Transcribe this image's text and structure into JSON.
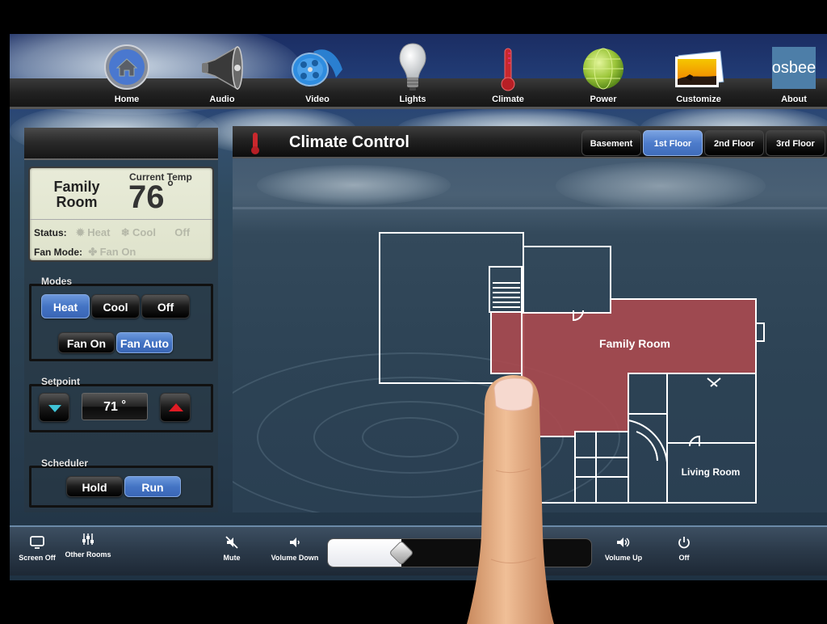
{
  "nav": {
    "items": [
      {
        "label": "Home",
        "icon": "home-icon",
        "active": true
      },
      {
        "label": "Audio",
        "icon": "speaker-icon"
      },
      {
        "label": "Video",
        "icon": "film-reel-icon"
      },
      {
        "label": "Lights",
        "icon": "light-bulb-icon"
      },
      {
        "label": "Climate",
        "icon": "thermometer-icon"
      },
      {
        "label": "Power",
        "icon": "globe-icon"
      },
      {
        "label": "Customize",
        "icon": "photos-icon"
      },
      {
        "label": "About",
        "icon": "osbee-logo-icon"
      }
    ],
    "logo_text": "osbee"
  },
  "status": {
    "room_name_line1": "Family",
    "room_name_line2": "Room",
    "current_temp_label": "Current Temp",
    "current_temp": "76",
    "degree_symbol": "°",
    "status_label": "Status:",
    "status_options": [
      "Heat",
      "Cool",
      "Off"
    ],
    "fan_mode_label": "Fan Mode:",
    "fan_mode_value": "Fan On"
  },
  "modes": {
    "title": "Modes",
    "buttons": [
      {
        "label": "Heat",
        "active": true
      },
      {
        "label": "Cool",
        "active": false
      },
      {
        "label": "Off",
        "active": false
      }
    ],
    "fan_buttons": [
      {
        "label": "Fan On",
        "active": false
      },
      {
        "label": "Fan Auto",
        "active": true
      }
    ]
  },
  "setpoint": {
    "title": "Setpoint",
    "value": "71",
    "degree_symbol": "°"
  },
  "scheduler": {
    "title": "Scheduler",
    "buttons": [
      {
        "label": "Hold",
        "active": false
      },
      {
        "label": "Run",
        "active": true
      }
    ]
  },
  "main": {
    "title": "Climate Control",
    "floor_tabs": [
      {
        "label": "Basement",
        "active": false
      },
      {
        "label": "1st Floor",
        "active": true
      },
      {
        "label": "2nd Floor",
        "active": false
      },
      {
        "label": "3rd Floor",
        "active": false
      }
    ],
    "rooms": {
      "family_room": "Family Room",
      "living_room": "Living Room"
    },
    "selected_room_color": "#a84a4f"
  },
  "bottom": {
    "screen_off": "Screen Off",
    "other_rooms": "Other Rooms",
    "mute": "Mute",
    "volume_down": "Volume Down",
    "volume_up": "Volume Up",
    "off": "Off",
    "volume_percent": 28
  },
  "colors": {
    "accent_blue": "#4d7ccb",
    "setpoint_down": "#3fc3d6",
    "setpoint_up": "#e01b24"
  }
}
